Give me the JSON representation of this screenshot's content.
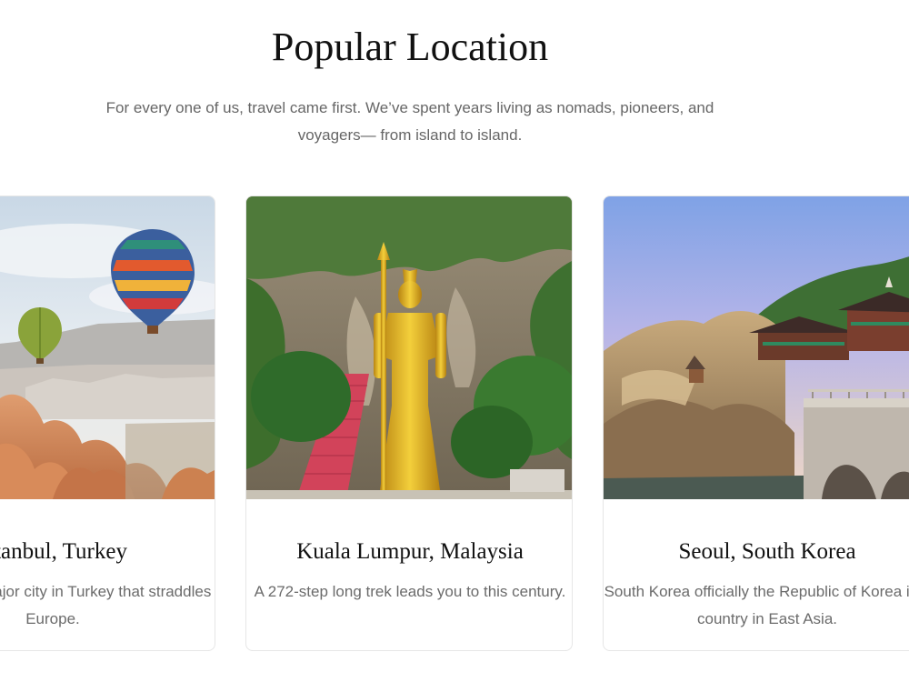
{
  "section": {
    "title": "Popular Location",
    "subtitle": "For every one of us, travel came first. We’ve spent years living as nomads, pioneers, and voyagers— from island to island."
  },
  "cards": [
    {
      "title": "Istanbul, Turkey",
      "description": "Istanbul is a major city in Turkey that straddles Europe.",
      "image": "hot-air-balloons-cappadocia"
    },
    {
      "title": "Kuala Lumpur, Malaysia",
      "description": "A 272-step long trek leads you to this century.",
      "image": "batu-caves-golden-statue"
    },
    {
      "title": "Seoul, South Korea",
      "description": "South Korea officially the Republic of Korea is a country in East Asia.",
      "image": "seaside-temple-bridge"
    }
  ]
}
